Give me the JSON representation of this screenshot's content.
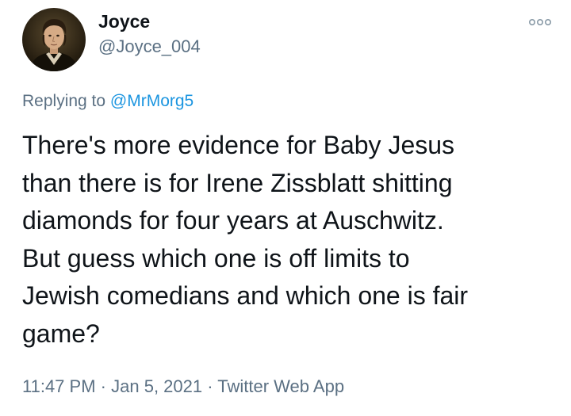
{
  "author": {
    "display_name": "Joyce",
    "handle": "@Joyce_004",
    "avatar_icon": "portrait-avatar"
  },
  "more_icon": "more-options-icon",
  "reply": {
    "prefix": "Replying to",
    "mention": "@MrMorg5"
  },
  "tweet": {
    "lines": [
      "There's more evidence for Baby Jesus",
      "than there is for Irene Zissblatt shitting",
      "diamonds for four years at Auschwitz.",
      "But guess which one is off limits to",
      "Jewish comedians and which one is fair",
      "game?"
    ]
  },
  "meta": {
    "time": "11:47 PM",
    "date": "Jan 5, 2021",
    "source": "Twitter Web App",
    "separator": "·"
  },
  "colors": {
    "text": "#0f1419",
    "secondary": "#5b7083",
    "link": "#1b95e0"
  }
}
